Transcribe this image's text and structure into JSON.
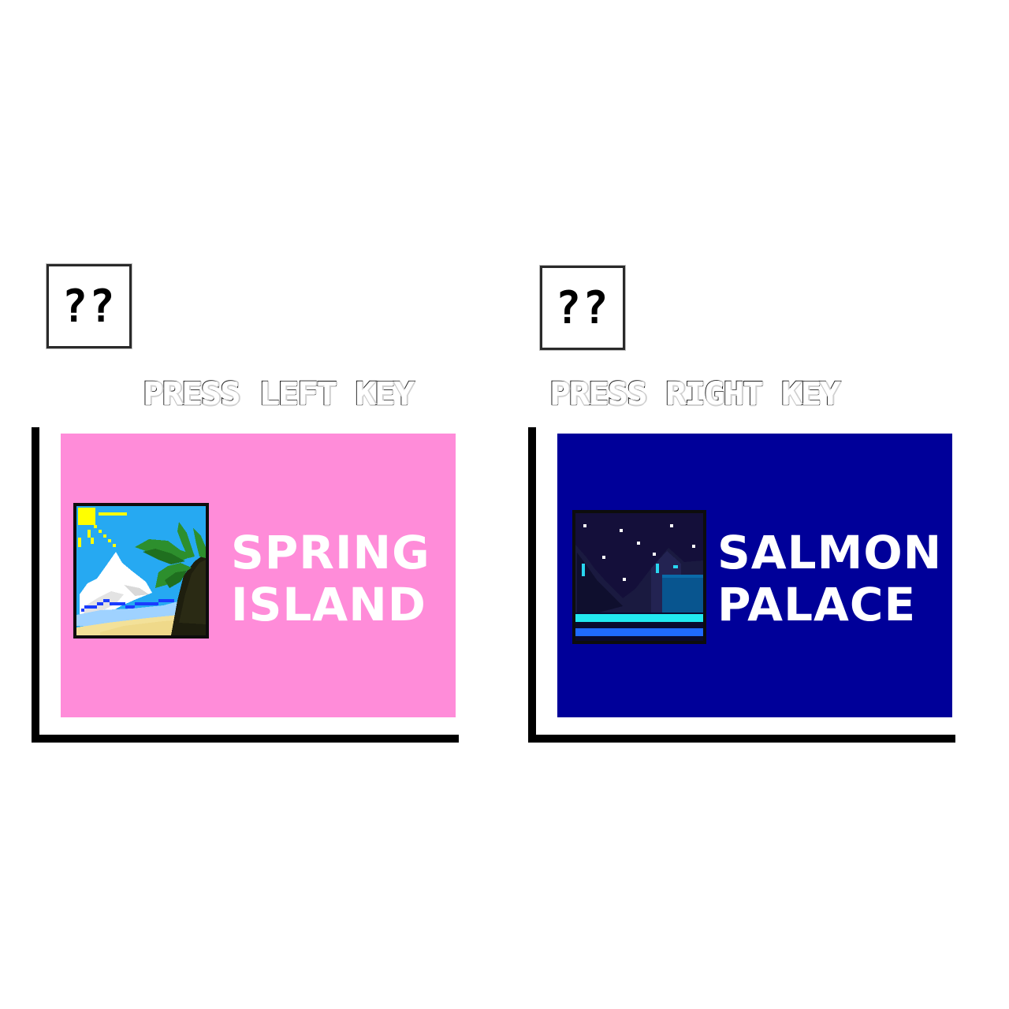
{
  "colors": {
    "background": "#ffffff",
    "card_shadow": "#000000",
    "spring_island_card": "#ff8cd9",
    "salmon_palace_card": "#000099",
    "title_text": "#ffffff"
  },
  "left_option": {
    "mystery_box_label": "??",
    "prompt": "PRESS LEFT KEY",
    "level_title_line1": "SPRING",
    "level_title_line2": "ISLAND",
    "thumbnail_icon": "beach-palm-tree-icon"
  },
  "right_option": {
    "mystery_box_label": "??",
    "prompt": "PRESS RIGHT KEY",
    "level_title_line1": "SALMON",
    "level_title_line2": "PALACE",
    "thumbnail_icon": "night-palace-icon"
  }
}
